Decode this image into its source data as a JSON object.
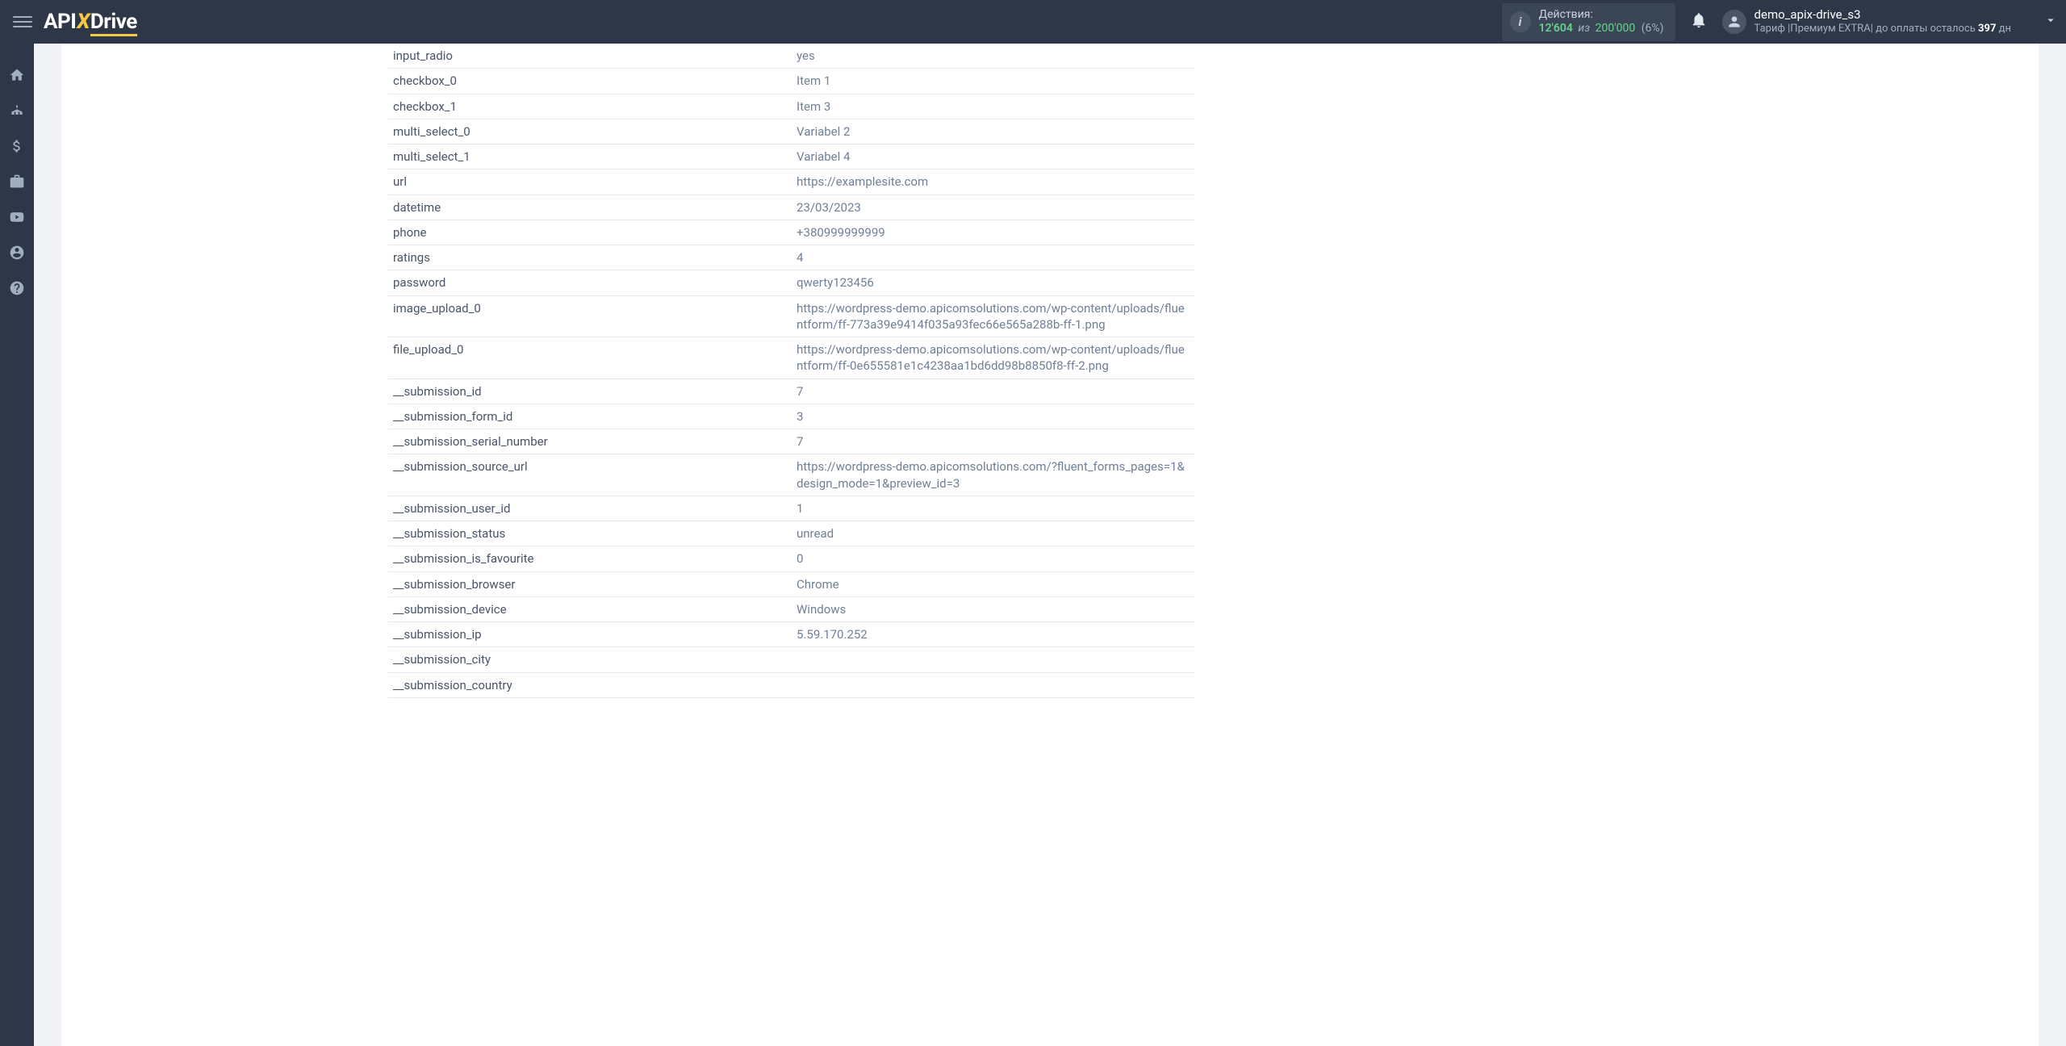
{
  "header": {
    "logo_api": "API",
    "logo_x": "X",
    "logo_drive": "Drive",
    "actions_label": "Действия:",
    "actions_used": "12'604",
    "actions_sep": "из",
    "actions_total": "200'000",
    "actions_pct": "(6%)",
    "user_name": "demo_apix-drive_s3",
    "user_plan_prefix": "Тариф |Премиум EXTRA| до оплаты осталось ",
    "user_plan_days": "397",
    "user_plan_suffix": " дн"
  },
  "rows": [
    {
      "k": "input_radio",
      "v": "yes"
    },
    {
      "k": "checkbox_0",
      "v": "Item 1"
    },
    {
      "k": "checkbox_1",
      "v": "Item 3"
    },
    {
      "k": "multi_select_0",
      "v": "Variabel 2"
    },
    {
      "k": "multi_select_1",
      "v": "Variabel 4"
    },
    {
      "k": "url",
      "v": "https://examplesite.com"
    },
    {
      "k": "datetime",
      "v": "23/03/2023"
    },
    {
      "k": "phone",
      "v": "+380999999999"
    },
    {
      "k": "ratings",
      "v": "4"
    },
    {
      "k": "password",
      "v": "qwerty123456"
    },
    {
      "k": "image_upload_0",
      "v": "https://wordpress-demo.apicomsolutions.com/wp-content/uploads/fluentform/ff-773a39e9414f035a93fec66e565a288b-ff-1.png"
    },
    {
      "k": "file_upload_0",
      "v": "https://wordpress-demo.apicomsolutions.com/wp-content/uploads/fluentform/ff-0e655581e1c4238aa1bd6dd98b8850f8-ff-2.png"
    },
    {
      "k": "__submission_id",
      "v": "7"
    },
    {
      "k": "__submission_form_id",
      "v": "3"
    },
    {
      "k": "__submission_serial_number",
      "v": "7"
    },
    {
      "k": "__submission_source_url",
      "v": "https://wordpress-demo.apicomsolutions.com/?fluent_forms_pages=1&design_mode=1&preview_id=3"
    },
    {
      "k": "__submission_user_id",
      "v": "1"
    },
    {
      "k": "__submission_status",
      "v": "unread"
    },
    {
      "k": "__submission_is_favourite",
      "v": "0"
    },
    {
      "k": "__submission_browser",
      "v": "Chrome"
    },
    {
      "k": "__submission_device",
      "v": "Windows"
    },
    {
      "k": "__submission_ip",
      "v": "5.59.170.252"
    },
    {
      "k": "__submission_city",
      "v": ""
    },
    {
      "k": "__submission_country",
      "v": ""
    }
  ]
}
